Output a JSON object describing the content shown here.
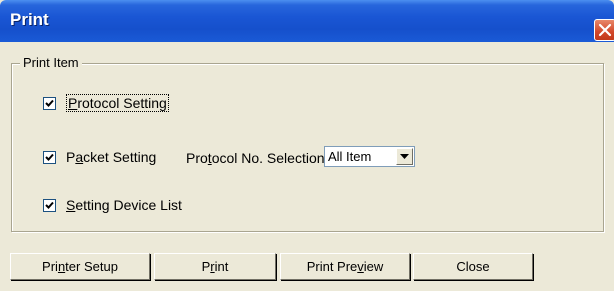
{
  "window": {
    "title": "Print"
  },
  "group": {
    "label": "Print Item"
  },
  "options": {
    "protocol_setting": {
      "pre": "",
      "key": "P",
      "post": "rotocol Setting",
      "checked": true
    },
    "packet_setting": {
      "pre": "P",
      "key": "a",
      "post": "cket Setting",
      "checked": true
    },
    "setting_device_list": {
      "pre": "",
      "key": "S",
      "post": "etting Device List",
      "checked": true
    }
  },
  "protocol_selection": {
    "label_pre": "Pro",
    "label_key": "t",
    "label_post": "ocol No. Selection",
    "selected": "All Item"
  },
  "buttons": {
    "printer_setup": {
      "pre": "Pri",
      "key": "n",
      "post": "ter Setup"
    },
    "print": {
      "pre": "P",
      "key": "r",
      "post": "int"
    },
    "print_preview": {
      "pre": "Print Pre",
      "key": "v",
      "post": "iew"
    },
    "close": {
      "pre": "Close",
      "key": "",
      "post": ""
    }
  },
  "colors": {
    "title_bar": "#1a56d4",
    "dialog_bg": "#ece9d8",
    "close_button": "#d2482a"
  }
}
